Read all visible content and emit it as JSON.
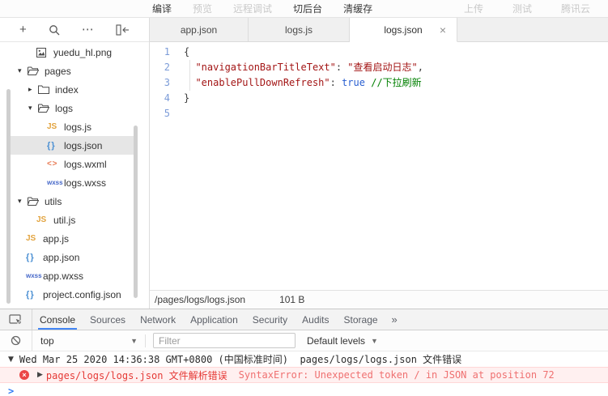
{
  "toolbar": {
    "left": [
      {
        "label": "编译",
        "enabled": true
      },
      {
        "label": "预览",
        "enabled": false
      },
      {
        "label": "远程调试",
        "enabled": false
      },
      {
        "label": "切后台",
        "enabled": true
      },
      {
        "label": "清缓存",
        "enabled": true
      }
    ],
    "right": [
      {
        "label": "上传",
        "enabled": false
      },
      {
        "label": "测试",
        "enabled": false
      },
      {
        "label": "腾讯云",
        "enabled": false
      }
    ]
  },
  "explorer": {
    "tree": [
      {
        "label": "yuedu_hl.png",
        "icon": "image",
        "indent": 1
      },
      {
        "label": "pages",
        "icon": "folder-open",
        "arrow": "expanded",
        "indent": 0
      },
      {
        "label": "index",
        "icon": "folder-closed",
        "arrow": "collapsed",
        "indent": 1
      },
      {
        "label": "logs",
        "icon": "folder-open",
        "arrow": "expanded",
        "indent": 1
      },
      {
        "label": "logs.js",
        "icon": "js",
        "indent": 2
      },
      {
        "label": "logs.json",
        "icon": "json",
        "indent": 2,
        "selected": true
      },
      {
        "label": "logs.wxml",
        "icon": "wxml",
        "indent": 2
      },
      {
        "label": "logs.wxss",
        "icon": "wxss",
        "indent": 2
      },
      {
        "label": "utils",
        "icon": "folder-open",
        "arrow": "expanded",
        "indent": 0
      },
      {
        "label": "util.js",
        "icon": "js",
        "indent": 1
      },
      {
        "label": "app.js",
        "icon": "js",
        "indent": 0
      },
      {
        "label": "app.json",
        "icon": "json",
        "indent": 0
      },
      {
        "label": "app.wxss",
        "icon": "wxss",
        "indent": 0
      },
      {
        "label": "project.config.json",
        "icon": "json",
        "indent": 0
      }
    ]
  },
  "editor": {
    "tabs": [
      {
        "label": "app.json",
        "active": false
      },
      {
        "label": "logs.js",
        "active": false
      },
      {
        "label": "logs.json",
        "active": true,
        "closable": true
      }
    ],
    "code_lines": [
      {
        "num": "1",
        "tokens": [
          {
            "t": "punct",
            "v": "{"
          }
        ]
      },
      {
        "num": "2",
        "tokens": [
          {
            "t": "ws",
            "v": "  "
          },
          {
            "t": "key",
            "v": "\"navigationBarTitleText\""
          },
          {
            "t": "punct",
            "v": ": "
          },
          {
            "t": "string",
            "v": "\"查看启动日志\""
          },
          {
            "t": "punct",
            "v": ","
          }
        ]
      },
      {
        "num": "3",
        "tokens": [
          {
            "t": "ws",
            "v": "  "
          },
          {
            "t": "key",
            "v": "\"enablePullDownRefresh\""
          },
          {
            "t": "punct",
            "v": ": "
          },
          {
            "t": "bool",
            "v": "true"
          },
          {
            "t": "ws",
            "v": " "
          },
          {
            "t": "comment",
            "v": "//下拉刷新"
          }
        ]
      },
      {
        "num": "4",
        "tokens": [
          {
            "t": "punct",
            "v": "}"
          }
        ]
      },
      {
        "num": "5",
        "tokens": []
      }
    ],
    "status": {
      "path": "/pages/logs/logs.json",
      "size": "101 B"
    }
  },
  "devtools": {
    "tabs": [
      {
        "label": "Console",
        "active": true
      },
      {
        "label": "Sources",
        "active": false
      },
      {
        "label": "Network",
        "active": false
      },
      {
        "label": "Application",
        "active": false
      },
      {
        "label": "Security",
        "active": false
      },
      {
        "label": "Audits",
        "active": false
      },
      {
        "label": "Storage",
        "active": false
      }
    ],
    "more_tabs": "»",
    "context": "top",
    "filter_placeholder": "Filter",
    "levels": "Default levels",
    "log_message": "Wed Mar 25 2020 14:36:38 GMT+0800 (中国标准时间)  pages/logs/logs.json 文件错误",
    "error": {
      "source": "pages/logs/logs.json 文件解析错误",
      "detail": "SyntaxError: Unexpected token / in JSON at position 72"
    },
    "prompt": ">"
  },
  "glyphs": {
    "plus": "+",
    "more": "⋯",
    "arrow_expanded": "▾",
    "arrow_collapsed": "▸",
    "log_expanded": "▼",
    "log_collapsed": "▶",
    "close": "×",
    "dropdown": "▼",
    "error_mark": "×",
    "js": "JS",
    "json": "{ }",
    "wxml": "< >",
    "wxss": "wxss"
  },
  "colors": {
    "accent_blue": "#4285f4",
    "error_bg": "#fff0f0",
    "error_border": "#ffd7d7",
    "error_text": "#e53935",
    "error_detail": "#ef7070",
    "key": "#a31515",
    "string": "#a31515",
    "bool": "#2a5fd1",
    "comment": "#008000",
    "line_number": "#7b9bd8"
  }
}
